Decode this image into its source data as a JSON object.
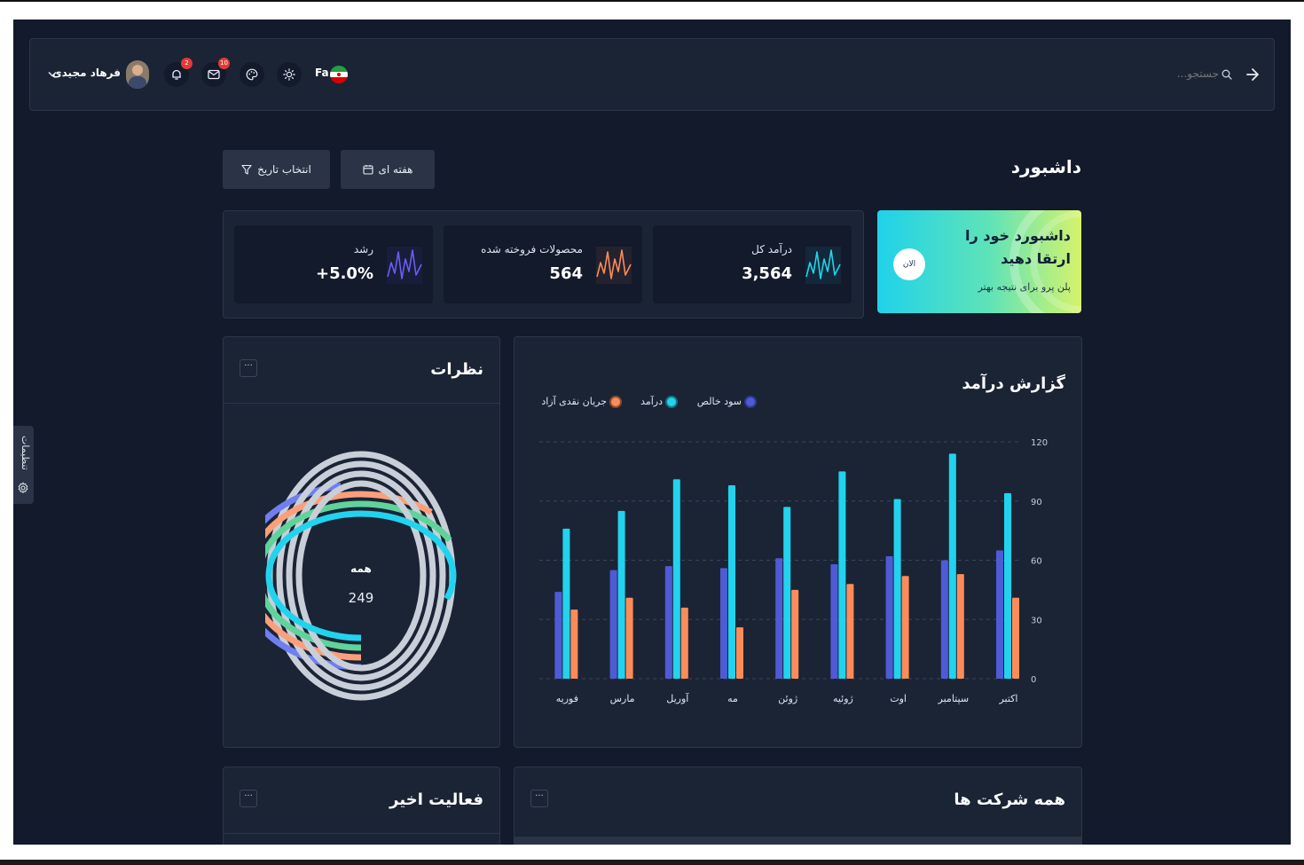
{
  "header": {
    "search_placeholder": "جستجو...",
    "language": "Fa",
    "user_name": "فرهاد مجیدی",
    "notifications_count": "2",
    "messages_count": "10"
  },
  "page": {
    "title": "داشبورد",
    "weekly_button": "هفته ای",
    "date_filter_button": "انتخاب تاریخ"
  },
  "upgrade": {
    "title": "داشبورد خود را ارتقا دهید",
    "subtitle": "پلن پرو برای نتیجه بهتر",
    "button": "الان"
  },
  "stats": [
    {
      "label": "درآمد کل",
      "value": "3,564",
      "color": "#22d3ee"
    },
    {
      "label": "محصولات فروخته شده",
      "value": "564",
      "color": "#fb8c5a"
    },
    {
      "label": "رشد",
      "value": "+5.0%",
      "color": "#6b5cf0"
    }
  ],
  "revenue": {
    "title": "گزارش درآمد",
    "chart_data": {
      "type": "bar",
      "categories": [
        "اکتبر",
        "سپتامبر",
        "اوت",
        "ژوئیه",
        "ژوئن",
        "مه",
        "آوریل",
        "مارس",
        "فوریه"
      ],
      "series": [
        {
          "name": "سود خالص",
          "color": "#4f5bd5",
          "values": [
            65,
            60,
            62,
            58,
            61,
            56,
            57,
            55,
            44
          ]
        },
        {
          "name": "درآمد",
          "color": "#22d3ee",
          "values": [
            94,
            114,
            91,
            105,
            87,
            98,
            101,
            85,
            76
          ]
        },
        {
          "name": "جریان نقدی آزاد",
          "color": "#fb8c5a",
          "values": [
            41,
            53,
            52,
            48,
            45,
            26,
            36,
            41,
            35
          ]
        }
      ],
      "y_ticks": [
        "0",
        "30",
        "60",
        "90",
        "120"
      ],
      "ylim": [
        0,
        120
      ],
      "grid": "horizontal dashed",
      "legend_position": "top-right"
    }
  },
  "reviews": {
    "title": "نظرات",
    "center_label": "همه",
    "center_value": "249",
    "rings": [
      {
        "color": "#6f7ff0",
        "fraction": 0.47
      },
      {
        "color": "#fb9f7a",
        "fraction": 0.62
      },
      {
        "color": "#5fd39a",
        "fraction": 0.68
      },
      {
        "color": "#22d3ee",
        "fraction": 0.8
      }
    ]
  },
  "companies": {
    "title": "همه شرکت ها"
  },
  "activity": {
    "title": "فعالیت اخیر"
  },
  "settings_tab": {
    "label": "تنظیمات"
  },
  "more_label": "···"
}
